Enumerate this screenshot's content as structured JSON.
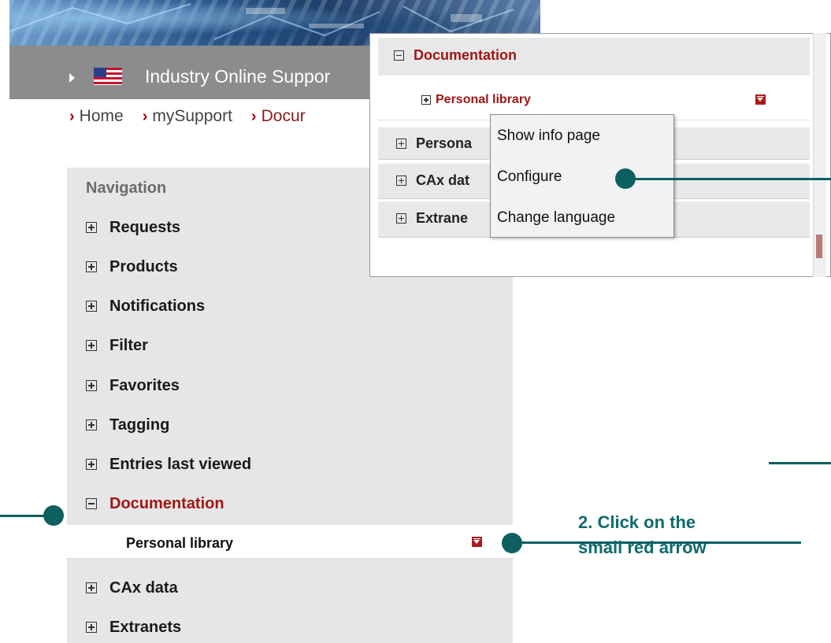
{
  "header": {
    "site_title": "Industry Online Suppor",
    "flag_icon": "us-flag-icon"
  },
  "breadcrumb": [
    {
      "label": "Home"
    },
    {
      "label": "mySupport"
    },
    {
      "label": "Docur"
    }
  ],
  "navigation": {
    "heading": "Navigation",
    "items": [
      {
        "label": "Requests",
        "state": "collapsed"
      },
      {
        "label": "Products",
        "state": "collapsed"
      },
      {
        "label": "Notifications",
        "state": "collapsed"
      },
      {
        "label": "Filter",
        "state": "collapsed"
      },
      {
        "label": "Favorites",
        "state": "collapsed"
      },
      {
        "label": "Tagging",
        "state": "collapsed"
      },
      {
        "label": "Entries last viewed",
        "state": "collapsed"
      },
      {
        "label": "Documentation",
        "state": "expanded"
      },
      {
        "label": "CAx data",
        "state": "collapsed"
      },
      {
        "label": "Extranets",
        "state": "collapsed"
      }
    ],
    "documentation_child": "Personal library"
  },
  "inset": {
    "documentation": "Documentation",
    "personal_library": "Personal library",
    "items": [
      "Persona",
      "CAx dat",
      "Extrane"
    ]
  },
  "context_menu": {
    "items": [
      "Show info page",
      "Configure",
      "Change language"
    ]
  },
  "annotation": {
    "step2_line1": "2. Click on the",
    "step2_line2": "small red arrow"
  },
  "colors": {
    "accent_red": "#a01616",
    "annotation_teal": "#0e5f5f",
    "titlebar_gray": "#8c8c8c",
    "nav_bg": "#e6e6e6"
  }
}
